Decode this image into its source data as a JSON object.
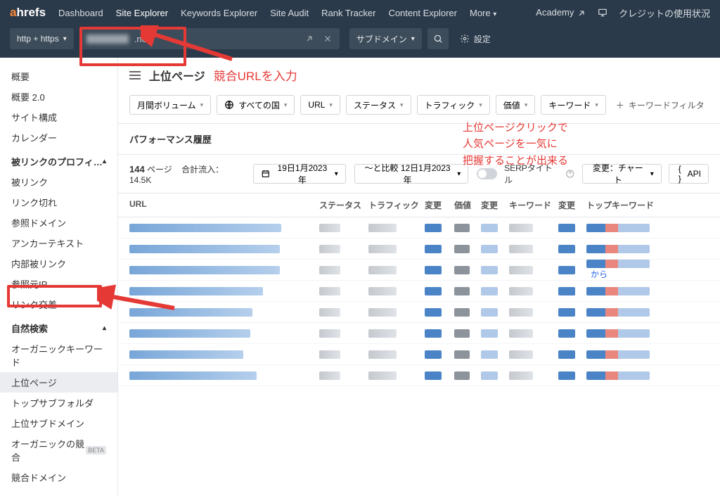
{
  "topbar": {
    "logo_a": "a",
    "logo_rest": "hrefs",
    "nav": [
      "Dashboard",
      "Site Explorer",
      "Keywords Explorer",
      "Site Audit",
      "Rank Tracker",
      "Content Explorer",
      "More"
    ],
    "active_nav_index": 1,
    "academy": "Academy",
    "credit": "クレジットの使用状況"
  },
  "search": {
    "protocol": "http + https",
    "domain_suffix": ".net/",
    "subdomain": "サブドメイン",
    "settings": "設定"
  },
  "sidebar": {
    "items_a": [
      "概要",
      "概要 2.0",
      "サイト構成",
      "カレンダー"
    ],
    "section_b": "被リンクのプロフィ…",
    "items_b": [
      "被リンク",
      "リンク切れ",
      "参照ドメイン",
      "アンカーテキスト",
      "内部被リンク",
      "参照元IP",
      "リンク交差"
    ],
    "section_c": "自然検索",
    "items_c": [
      "オーガニックキーワード",
      "上位ページ",
      "トップサブフォルダ",
      "上位サブドメイン",
      "オーガニックの競合",
      "競合ドメイン"
    ],
    "beta_label": "BETA"
  },
  "page": {
    "title": "上位ページ",
    "annotation_input": "競合URLを入力",
    "annotation_lines": [
      "上位ページクリックで",
      "人気ページを一気に",
      "把握することが出来る"
    ]
  },
  "filters": {
    "volume": "月間ボリューム",
    "country": "すべての国",
    "url": "URL",
    "status": "ステータス",
    "traffic": "トラフィック",
    "value": "価値",
    "keyword": "キーワード",
    "add": "キーワードフィルタ"
  },
  "perf_header": "パフォーマンス履歴",
  "summary": {
    "pages_count": "144",
    "pages_label": "ページ",
    "inflow_label": "合計流入：",
    "inflow_value": "14.5K",
    "date1": "19日1月2023年",
    "date_compare": "〜と比較 12日1月2023年",
    "serp_title": "SERPタイトル",
    "change_chart": "変更：チャート",
    "api": "API"
  },
  "table": {
    "headers": {
      "url": "URL",
      "status": "ステータス",
      "traffic": "トラフィック",
      "change": "変更",
      "value": "価値",
      "change2": "変更",
      "keyword": "キーワード",
      "change3": "変更",
      "topkw": "トップキーワード"
    },
    "link_suffix": "から",
    "rows": 8
  }
}
